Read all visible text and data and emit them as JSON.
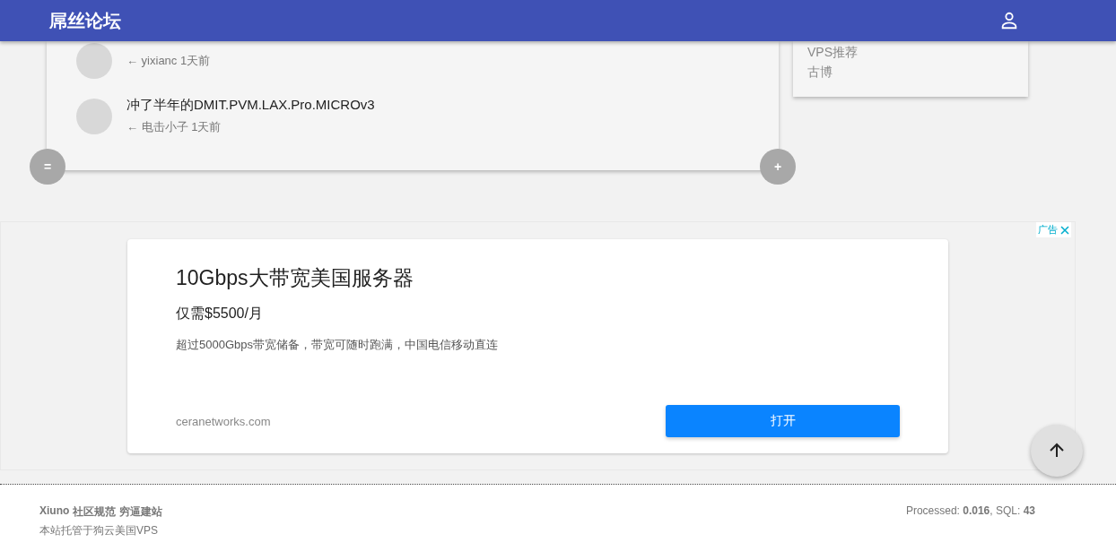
{
  "header": {
    "title": "屌丝论坛"
  },
  "threads": [
    {
      "meta": "← yixianc 1天前"
    },
    {
      "title": "冲了半年的DMIT.PVM.LAX.Pro.MICROv3",
      "meta": "← 电击小子 1天前"
    }
  ],
  "card_buttons": {
    "left": "=",
    "right": "+"
  },
  "side_links": [
    "VPS推荐",
    "古博"
  ],
  "ad": {
    "badge": "广告",
    "title": "10Gbps大带宽美国服务器",
    "price": "仅需$5500/月",
    "description": "超过5000Gbps带宽储备，带宽可随时跑满，中国电信移动直连",
    "domain": "ceranetworks.com",
    "button": "打开"
  },
  "footer": {
    "links": [
      "Xiuno",
      "社区规范",
      "穷逼建站"
    ],
    "hosting": "本站托管于狗云美国VPS",
    "stats": "Processed: **0.016**, SQL: **43**"
  }
}
